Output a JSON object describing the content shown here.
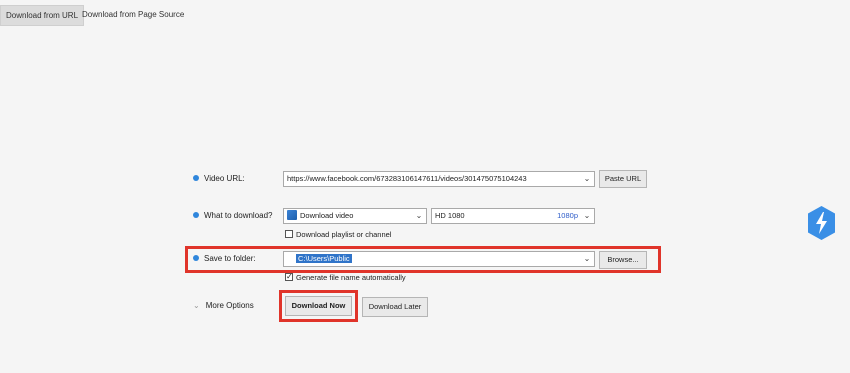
{
  "tabs": [
    {
      "label": "Download from URL",
      "active": true
    },
    {
      "label": "Download from Page Source",
      "active": false
    }
  ],
  "form": {
    "video_url": {
      "label": "Video URL:",
      "value": "https://www.facebook.com/673283106147611/videos/301475075104243",
      "button": "Paste URL"
    },
    "what_to_download": {
      "label": "What to download?",
      "type_value": "Download video",
      "quality_value": "HD 1080",
      "quality_res": "1080p",
      "playlist_checkbox": {
        "label": "Download playlist or channel",
        "checked": false
      }
    },
    "save_folder": {
      "label": "Save to folder:",
      "value": "C:\\Users\\Public",
      "button": "Browse...",
      "auto_name_checkbox": {
        "label": "Generate file name automatically",
        "checked": true
      }
    },
    "more_options": "More Options",
    "download_now": "Download Now",
    "download_later": "Download Later"
  },
  "icons": {
    "bullet_color": "#2f86dc",
    "bolt_color": "#3a8fe6",
    "highlight_frame_color": "#e0342a"
  }
}
